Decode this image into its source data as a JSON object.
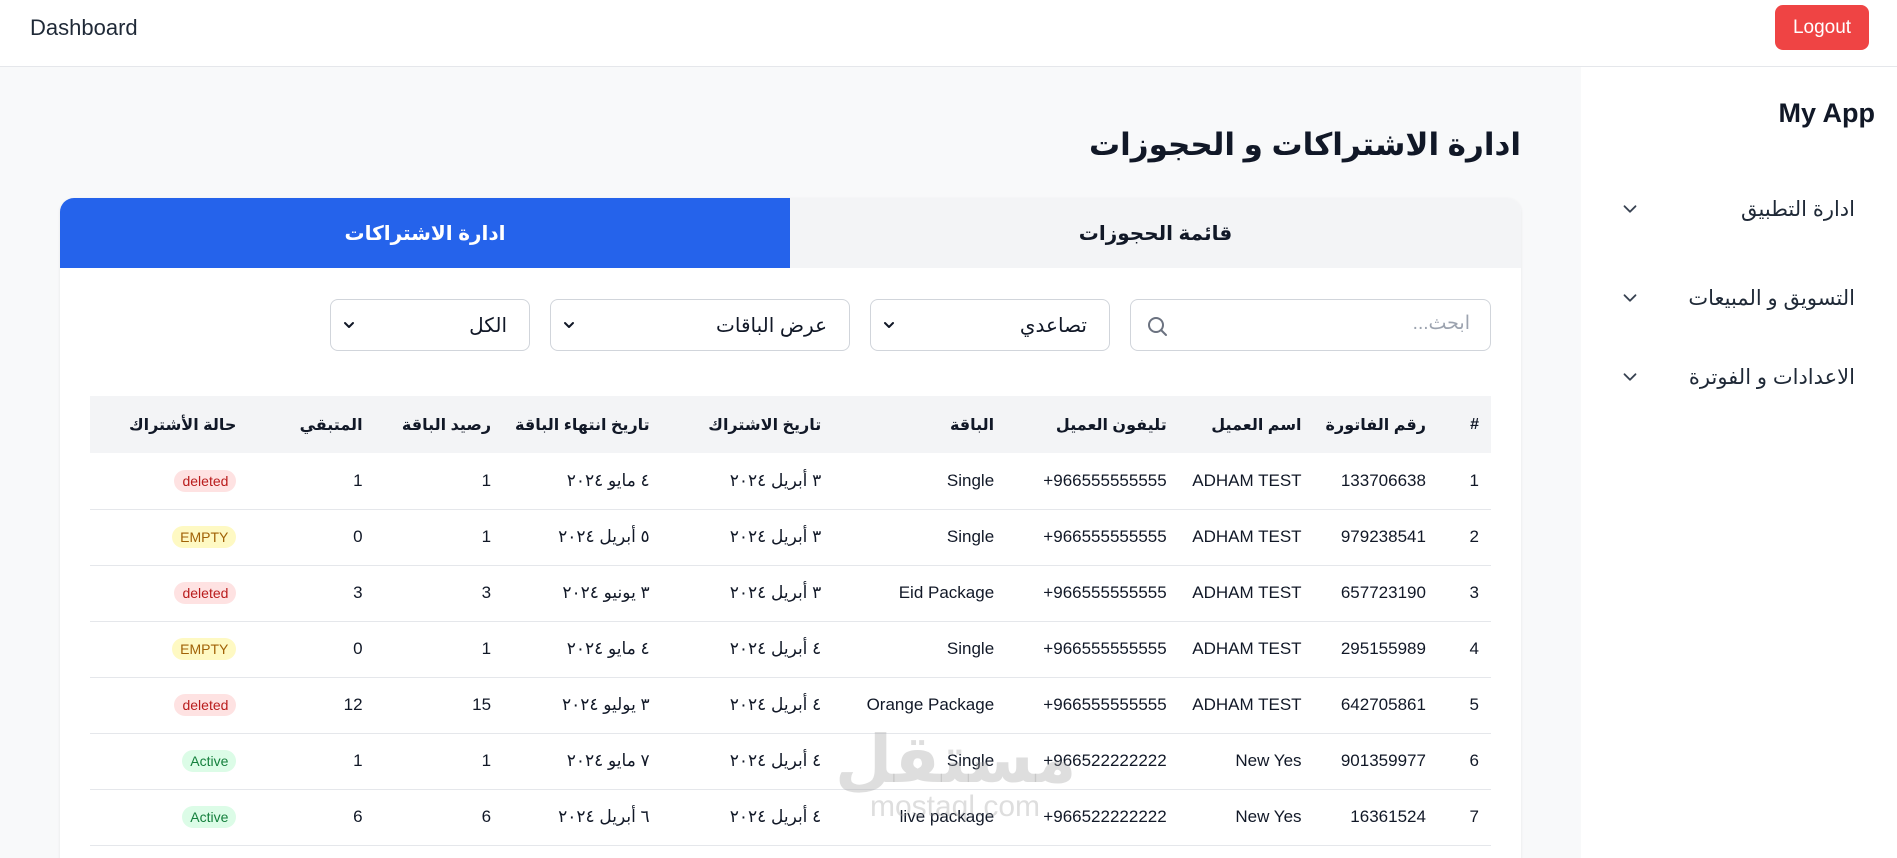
{
  "header": {
    "brand": "Dashboard",
    "logout_label": "Logout"
  },
  "sidebar": {
    "app_name": "My App",
    "items": [
      {
        "label": "ادارة التطبيق"
      },
      {
        "label": "التسويق و المبيعات"
      },
      {
        "label": "الاعدادات و الفوترة"
      }
    ]
  },
  "main": {
    "title": "ادارة الاشتراكات و الحجوزات",
    "tabs": [
      {
        "label": "قائمة الحجوزات",
        "active": false
      },
      {
        "label": "ادارة الاشتراكات",
        "active": true
      }
    ],
    "filters": {
      "search_placeholder": "ابحث...",
      "sort_value": "تصاعدي",
      "packages_value": "عرض الباقات",
      "status_value": "الكل"
    },
    "table": {
      "headers": [
        "#",
        "رقم الفاتورة",
        "اسم العميل",
        "تليفون العميل",
        "الباقة",
        "تاريخ الاشتراك",
        "تاريخ انتهاء الباقة",
        "رصيد الباقة",
        "المتبقي",
        "حالة الأشتراك"
      ],
      "rows": [
        [
          "1",
          "133706638",
          "ADHAM TEST",
          "966555555555+",
          "Single",
          "٣ أبريل ٢٠٢٤",
          "٤ مايو ٢٠٢٤",
          "1",
          "1",
          "deleted"
        ],
        [
          "2",
          "979238541",
          "ADHAM TEST",
          "966555555555+",
          "Single",
          "٣ أبريل ٢٠٢٤",
          "٥ أبريل ٢٠٢٤",
          "1",
          "0",
          "EMPTY"
        ],
        [
          "3",
          "657723190",
          "ADHAM TEST",
          "966555555555+",
          "Eid Package",
          "٣ أبريل ٢٠٢٤",
          "٣ يونيو ٢٠٢٤",
          "3",
          "3",
          "deleted"
        ],
        [
          "4",
          "295155989",
          "ADHAM TEST",
          "966555555555+",
          "Single",
          "٤ أبريل ٢٠٢٤",
          "٤ مايو ٢٠٢٤",
          "1",
          "0",
          "EMPTY"
        ],
        [
          "5",
          "642705861",
          "ADHAM TEST",
          "966555555555+",
          "Orange Package",
          "٤ أبريل ٢٠٢٤",
          "٣ يوليو ٢٠٢٤",
          "15",
          "12",
          "deleted"
        ],
        [
          "6",
          "901359977",
          "New Yes",
          "966522222222+",
          "Single",
          "٤ أبريل ٢٠٢٤",
          "٧ مايو ٢٠٢٤",
          "1",
          "1",
          "Active"
        ],
        [
          "7",
          "16361524",
          "New Yes",
          "966522222222+",
          "live package",
          "٤ أبريل ٢٠٢٤",
          "٦ أبريل ٢٠٢٤",
          "6",
          "6",
          "Active"
        ]
      ]
    }
  },
  "watermark": {
    "arabic": "مستقل",
    "latin": "mostaql.com"
  },
  "colors": {
    "primary": "#2563eb",
    "logout": "#ef4444",
    "deleted": "#b91c1c",
    "empty": "#a16207",
    "active": "#15803d"
  }
}
